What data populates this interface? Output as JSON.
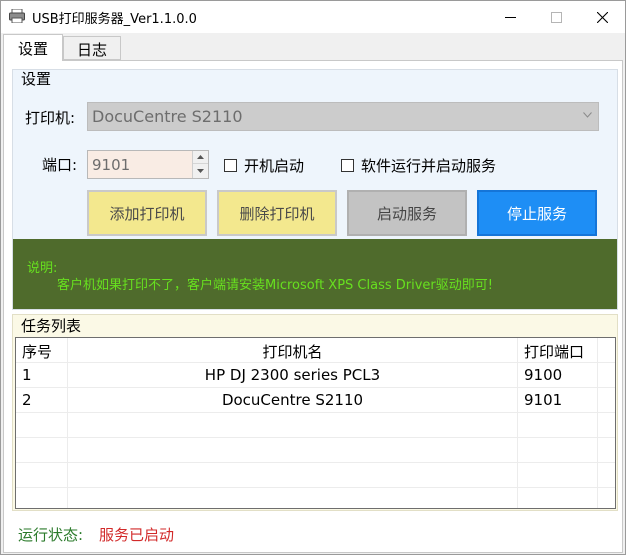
{
  "window": {
    "title": "USB打印服务器_Ver1.1.0.0",
    "accent": "#1e8ef5"
  },
  "tabs": [
    {
      "label": "设置",
      "selected": true
    },
    {
      "label": "日志",
      "selected": false
    }
  ],
  "settings": {
    "group_title": "设置",
    "printer_label": "打印机:",
    "printer_selected": "DocuCentre S2110",
    "port_label": "端口:",
    "port_value": "9101",
    "autostart_label": "开机启动",
    "autostart_checked": false,
    "run_start_service_label": "软件运行并启动服务",
    "run_start_service_checked": false,
    "buttons": {
      "add_printer": "添加打印机",
      "delete_printer": "删除打印机",
      "start_service": "启动服务",
      "stop_service": "停止服务"
    },
    "note_title": "说明:",
    "note_text": "客户机如果打印不了，客户端请安装Microsoft XPS Class Driver驱动即可!"
  },
  "tasks": {
    "group_title": "任务列表",
    "columns": [
      "序号",
      "打印机名",
      "打印端口"
    ],
    "rows": [
      [
        "1",
        "HP DJ 2300 series PCL3",
        "9100"
      ],
      [
        "2",
        "DocuCentre S2110",
        "9101"
      ]
    ]
  },
  "status": {
    "label": "运行状态:",
    "value": "服务已启动"
  }
}
